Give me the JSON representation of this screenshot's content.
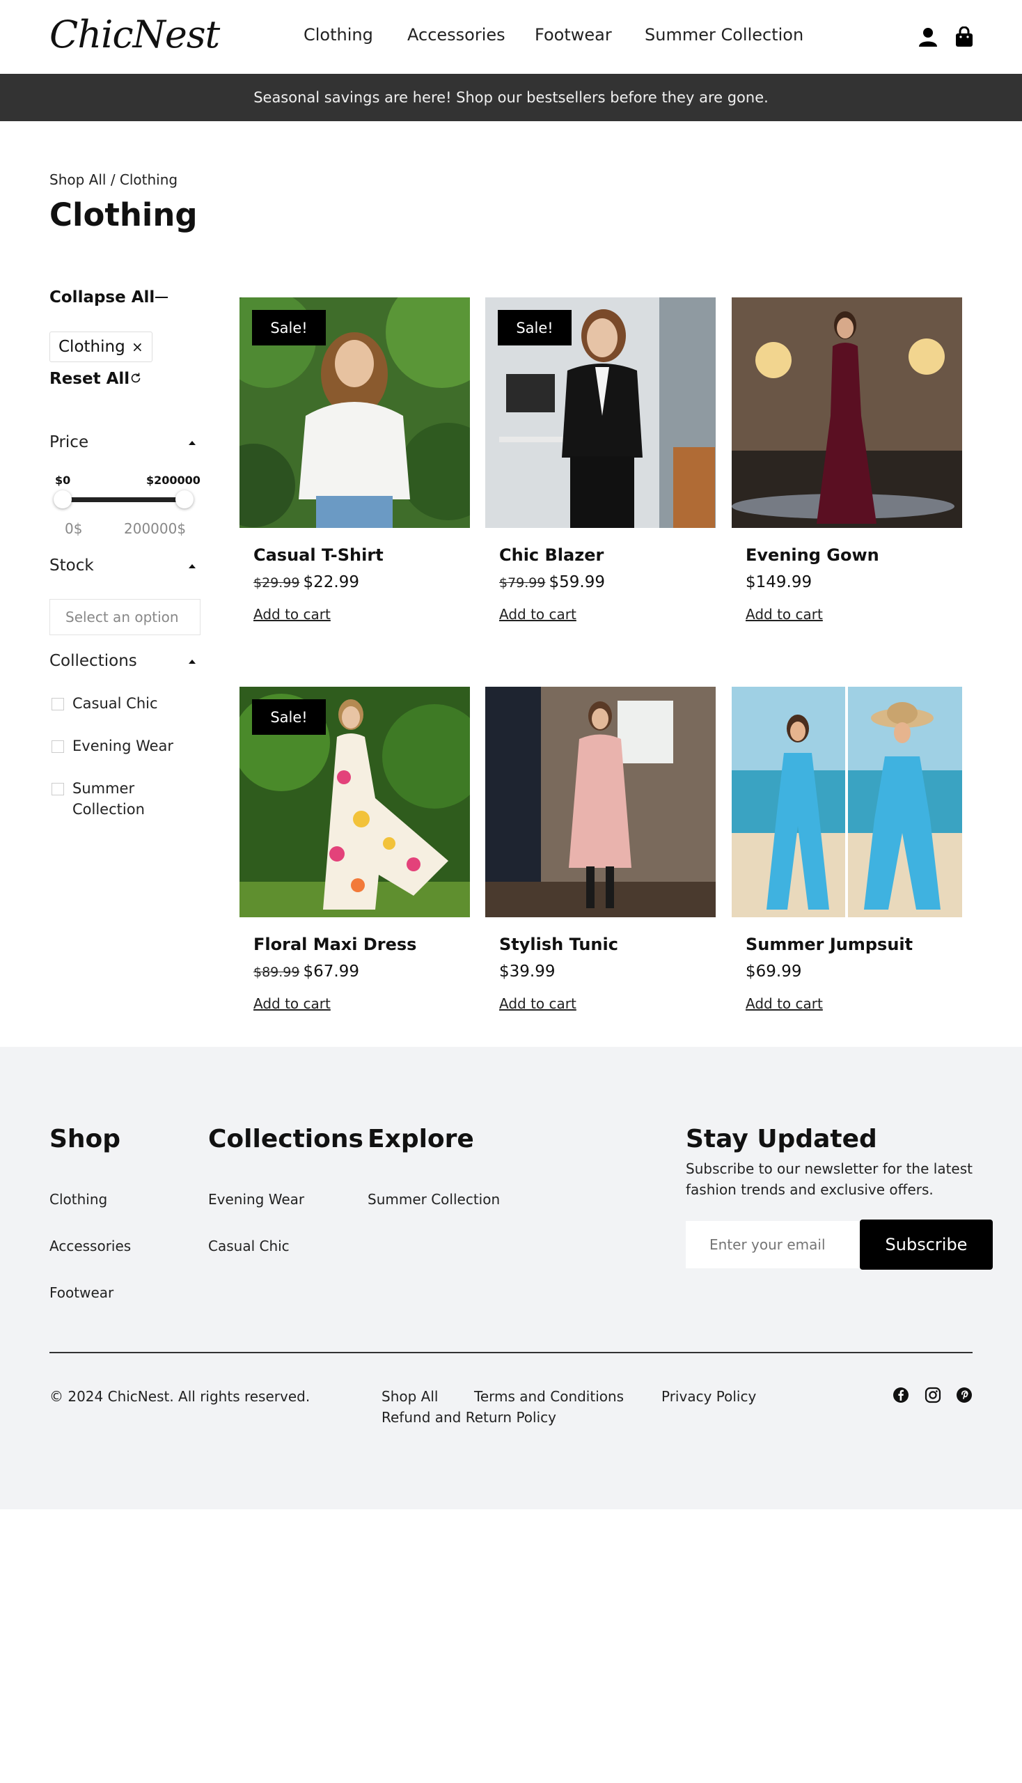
{
  "header": {
    "logo": "ChicNest",
    "nav": [
      "Clothing",
      "Accessories",
      "Footwear",
      "Summer Collection"
    ],
    "icons": [
      "user-icon",
      "bag-icon"
    ]
  },
  "banner": {
    "text": "Seasonal savings are here! Shop our bestsellers before they are gone."
  },
  "breadcrumb": "Shop All / Clothing",
  "page_title": "Clothing",
  "filters": {
    "collapse_all": "Collapse All",
    "active_chip": "Clothing",
    "chip_remove": "×",
    "reset_all": "Reset All",
    "price": {
      "title": "Price",
      "min_label": "$0",
      "max_label": "$200000",
      "min_value": "0$",
      "max_value": "200000$"
    },
    "stock": {
      "title": "Stock",
      "placeholder": "Select an option"
    },
    "collections": {
      "title": "Collections",
      "options": [
        "Casual Chic",
        "Evening Wear",
        "Summer",
        "Collection"
      ]
    }
  },
  "products": [
    {
      "name": "Casual T-Shirt",
      "old_price": "$29.99",
      "price": "$22.99",
      "sale": "Sale!",
      "cta": "Add to cart"
    },
    {
      "name": "Chic Blazer",
      "old_price": "$79.99",
      "price": "$59.99",
      "sale": "Sale!",
      "cta": "Add to cart"
    },
    {
      "name": "Evening Gown",
      "old_price": "",
      "price": "$149.99",
      "sale": "",
      "cta": "Add to cart"
    },
    {
      "name": "Floral Maxi Dress",
      "old_price": "$89.99",
      "price": "$67.99",
      "sale": "Sale!",
      "cta": "Add to cart"
    },
    {
      "name": "Stylish Tunic",
      "old_price": "",
      "price": "$39.99",
      "sale": "",
      "cta": "Add to cart"
    },
    {
      "name": "Summer Jumpsuit",
      "old_price": "",
      "price": "$69.99",
      "sale": "",
      "cta": "Add to cart"
    }
  ],
  "footer": {
    "shop": {
      "title": "Shop",
      "links": [
        "Clothing",
        "Accessories",
        "Footwear"
      ]
    },
    "collections": {
      "title": "Collections",
      "links": [
        "Evening Wear",
        "Casual Chic"
      ]
    },
    "explore": {
      "title": "Explore",
      "links": [
        "Summer Collection"
      ]
    },
    "newsletter": {
      "title": "Stay Updated",
      "text": "Subscribe to our newsletter for the latest fashion trends and exclusive offers.",
      "placeholder": "Enter your email",
      "button": "Subscribe"
    },
    "copyright": "© 2024 ChicNest. All rights reserved.",
    "legal_links": [
      "Shop All",
      "Terms and Conditions",
      "Privacy Policy",
      "Refund and Return Policy"
    ],
    "social_icons": [
      "facebook-icon",
      "instagram-icon",
      "pinterest-icon"
    ]
  }
}
